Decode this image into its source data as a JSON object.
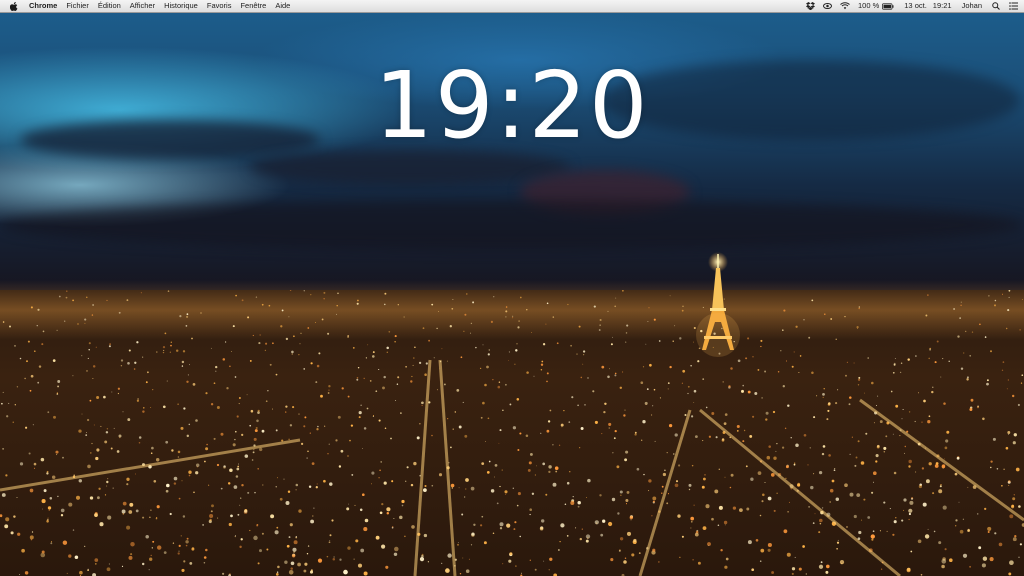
{
  "menubar": {
    "app_name": "Chrome",
    "menus": [
      "Fichier",
      "Édition",
      "Afficher",
      "Historique",
      "Favoris",
      "Fenêtre",
      "Aide"
    ],
    "status": {
      "battery_percent": "100 %",
      "date": "13 oct.",
      "time": "19:21",
      "user": "Johan"
    },
    "icons": [
      "apple-icon",
      "dropbox-icon",
      "sync-icon",
      "wifi-icon",
      "battery-icon",
      "spotlight-icon",
      "notification-center-icon"
    ]
  },
  "clock": {
    "time": "19:20"
  },
  "colors": {
    "sky_top": "#1d5f8e",
    "city_lights": "#ffb347",
    "menubar_bg": "#ececec"
  }
}
